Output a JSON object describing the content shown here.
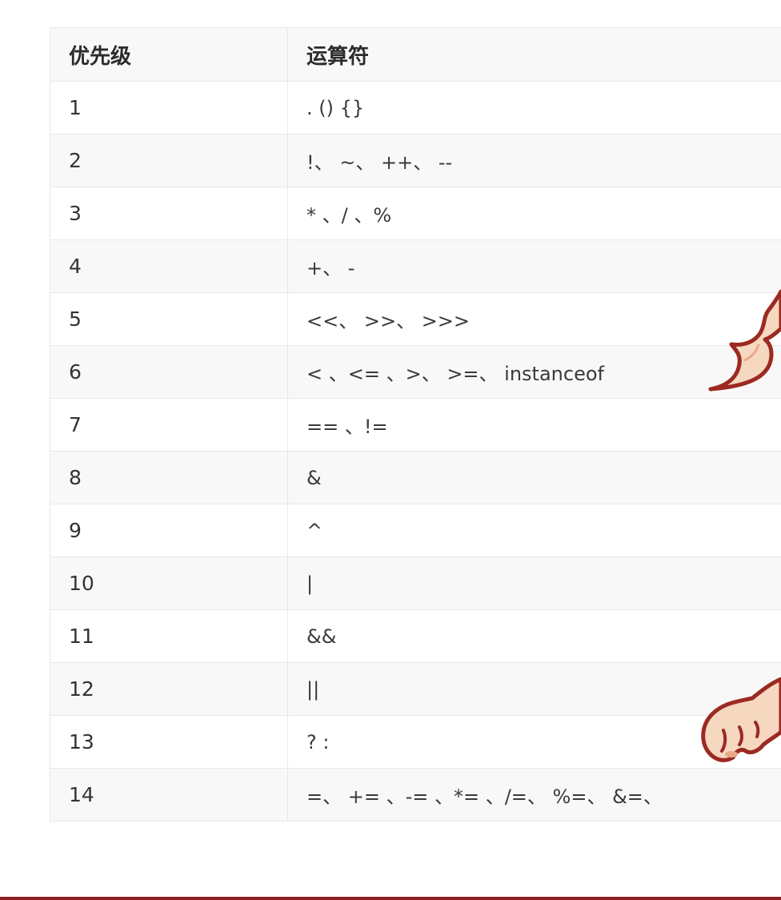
{
  "table": {
    "headers": [
      "优先级",
      "运算符"
    ],
    "rows": [
      {
        "priority": "1",
        "operators": ". () {}"
      },
      {
        "priority": "2",
        "operators": "!、 ~、 ++、 --"
      },
      {
        "priority": "3",
        "operators": "* 、/ 、%"
      },
      {
        "priority": "4",
        "operators": "+、 -"
      },
      {
        "priority": "5",
        "operators": "<<、 >>、 >>>"
      },
      {
        "priority": "6",
        "operators": "< 、<= 、>、 >=、 instanceof"
      },
      {
        "priority": "7",
        "operators": "== 、!="
      },
      {
        "priority": "8",
        "operators": "&"
      },
      {
        "priority": "9",
        "operators": "^"
      },
      {
        "priority": "10",
        "operators": "|"
      },
      {
        "priority": "11",
        "operators": "&&"
      },
      {
        "priority": "12",
        "operators": "||"
      },
      {
        "priority": "13",
        "operators": "? :"
      },
      {
        "priority": "14",
        "operators": "=、 += 、-= 、*= 、/=、 %=、 &=、"
      }
    ]
  },
  "stickers": [
    "cat-tail-sticker",
    "cat-paw-sticker"
  ],
  "colors": {
    "border": "#e8e8e8",
    "stripe": "#f8f8f8",
    "text": "#333333",
    "bottom_bar": "#8c1f1f",
    "sticker_outline": "#9b2a22",
    "sticker_fill": "#f6d7bf"
  }
}
